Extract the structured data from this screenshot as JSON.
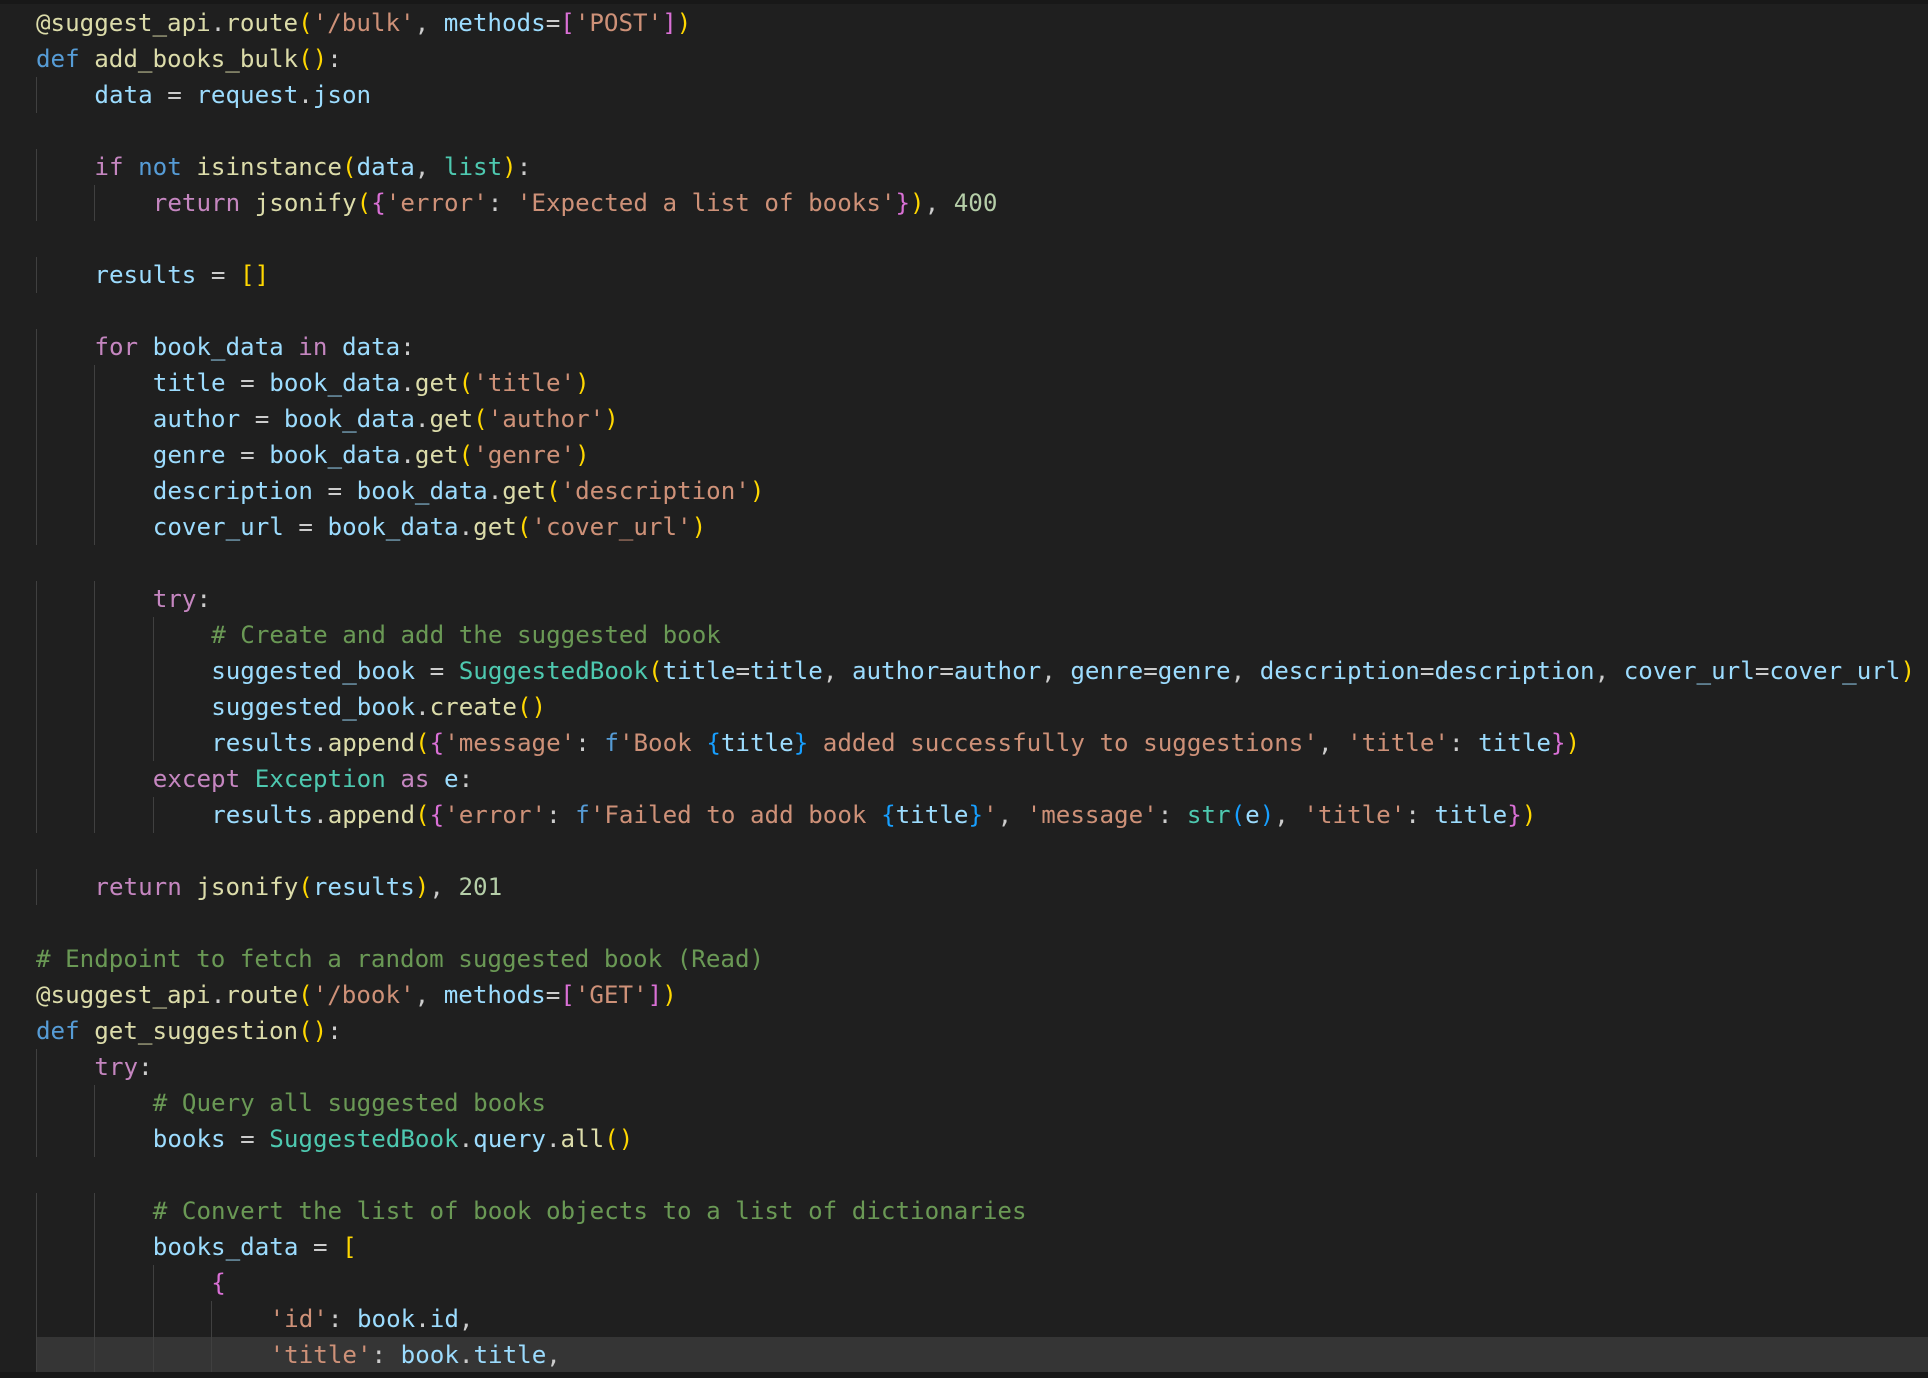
{
  "editor": {
    "language": "python",
    "current_line_index": 37,
    "colors": {
      "background": "#1f1f1f",
      "current_line": "#353535",
      "indent_guide": "#404040",
      "keyword": "#569cd6",
      "control": "#c586c0",
      "function": "#dcdcaa",
      "variable": "#9cdcfe",
      "string": "#ce9178",
      "number": "#b5cea8",
      "comment": "#6a9955",
      "class": "#4ec9b0",
      "bracket_gold": "#ffd700",
      "bracket_purple": "#da70d6",
      "bracket_blue": "#179fff",
      "plain": "#cccccc"
    },
    "lines": [
      {
        "indent": 0,
        "tokens": [
          [
            "@suggest_api",
            "fn"
          ],
          [
            ".",
            "p"
          ],
          [
            "route",
            "fn"
          ],
          [
            "(",
            "b1"
          ],
          [
            "'/bulk'",
            "str"
          ],
          [
            ", ",
            "p"
          ],
          [
            "methods",
            "var"
          ],
          [
            "=",
            "p"
          ],
          [
            "[",
            "b2"
          ],
          [
            "'POST'",
            "str"
          ],
          [
            "]",
            "b2"
          ],
          [
            ")",
            "b1"
          ]
        ]
      },
      {
        "indent": 0,
        "tokens": [
          [
            "def",
            "kw"
          ],
          [
            " ",
            "p"
          ],
          [
            "add_books_bulk",
            "fn"
          ],
          [
            "()",
            "b1"
          ],
          [
            ":",
            "p"
          ]
        ]
      },
      {
        "indent": 1,
        "tokens": [
          [
            "data",
            "var"
          ],
          [
            " = ",
            "p"
          ],
          [
            "request",
            "var"
          ],
          [
            ".",
            "p"
          ],
          [
            "json",
            "var"
          ]
        ]
      },
      {
        "indent": 0,
        "tokens": []
      },
      {
        "indent": 1,
        "tokens": [
          [
            "if",
            "ctl"
          ],
          [
            " ",
            "p"
          ],
          [
            "not",
            "kw"
          ],
          [
            " ",
            "p"
          ],
          [
            "isinstance",
            "fn"
          ],
          [
            "(",
            "b1"
          ],
          [
            "data",
            "var"
          ],
          [
            ", ",
            "p"
          ],
          [
            "list",
            "cls"
          ],
          [
            ")",
            "b1"
          ],
          [
            ":",
            "p"
          ]
        ]
      },
      {
        "indent": 2,
        "tokens": [
          [
            "return",
            "ctl"
          ],
          [
            " ",
            "p"
          ],
          [
            "jsonify",
            "fn"
          ],
          [
            "(",
            "b1"
          ],
          [
            "{",
            "b2"
          ],
          [
            "'error'",
            "str"
          ],
          [
            ": ",
            "p"
          ],
          [
            "'Expected a list of books'",
            "str"
          ],
          [
            "}",
            "b2"
          ],
          [
            ")",
            "b1"
          ],
          [
            ", ",
            "p"
          ],
          [
            "400",
            "num"
          ]
        ]
      },
      {
        "indent": 0,
        "tokens": []
      },
      {
        "indent": 1,
        "tokens": [
          [
            "results",
            "var"
          ],
          [
            " = ",
            "p"
          ],
          [
            "[]",
            "b1"
          ]
        ]
      },
      {
        "indent": 0,
        "tokens": []
      },
      {
        "indent": 1,
        "tokens": [
          [
            "for",
            "ctl"
          ],
          [
            " ",
            "p"
          ],
          [
            "book_data",
            "var"
          ],
          [
            " ",
            "p"
          ],
          [
            "in",
            "ctl"
          ],
          [
            " ",
            "p"
          ],
          [
            "data",
            "var"
          ],
          [
            ":",
            "p"
          ]
        ]
      },
      {
        "indent": 2,
        "tokens": [
          [
            "title",
            "var"
          ],
          [
            " = ",
            "p"
          ],
          [
            "book_data",
            "var"
          ],
          [
            ".",
            "p"
          ],
          [
            "get",
            "fn"
          ],
          [
            "(",
            "b1"
          ],
          [
            "'title'",
            "str"
          ],
          [
            ")",
            "b1"
          ]
        ]
      },
      {
        "indent": 2,
        "tokens": [
          [
            "author",
            "var"
          ],
          [
            " = ",
            "p"
          ],
          [
            "book_data",
            "var"
          ],
          [
            ".",
            "p"
          ],
          [
            "get",
            "fn"
          ],
          [
            "(",
            "b1"
          ],
          [
            "'author'",
            "str"
          ],
          [
            ")",
            "b1"
          ]
        ]
      },
      {
        "indent": 2,
        "tokens": [
          [
            "genre",
            "var"
          ],
          [
            " = ",
            "p"
          ],
          [
            "book_data",
            "var"
          ],
          [
            ".",
            "p"
          ],
          [
            "get",
            "fn"
          ],
          [
            "(",
            "b1"
          ],
          [
            "'genre'",
            "str"
          ],
          [
            ")",
            "b1"
          ]
        ]
      },
      {
        "indent": 2,
        "tokens": [
          [
            "description",
            "var"
          ],
          [
            " = ",
            "p"
          ],
          [
            "book_data",
            "var"
          ],
          [
            ".",
            "p"
          ],
          [
            "get",
            "fn"
          ],
          [
            "(",
            "b1"
          ],
          [
            "'description'",
            "str"
          ],
          [
            ")",
            "b1"
          ]
        ]
      },
      {
        "indent": 2,
        "tokens": [
          [
            "cover_url",
            "var"
          ],
          [
            " = ",
            "p"
          ],
          [
            "book_data",
            "var"
          ],
          [
            ".",
            "p"
          ],
          [
            "get",
            "fn"
          ],
          [
            "(",
            "b1"
          ],
          [
            "'cover_url'",
            "str"
          ],
          [
            ")",
            "b1"
          ]
        ]
      },
      {
        "indent": 0,
        "tokens": []
      },
      {
        "indent": 2,
        "tokens": [
          [
            "try",
            "ctl"
          ],
          [
            ":",
            "p"
          ]
        ]
      },
      {
        "indent": 3,
        "tokens": [
          [
            "# Create and add the suggested book",
            "cmt"
          ]
        ]
      },
      {
        "indent": 3,
        "tokens": [
          [
            "suggested_book",
            "var"
          ],
          [
            " = ",
            "p"
          ],
          [
            "SuggestedBook",
            "cls"
          ],
          [
            "(",
            "b1"
          ],
          [
            "title",
            "var"
          ],
          [
            "=",
            "p"
          ],
          [
            "title",
            "var"
          ],
          [
            ", ",
            "p"
          ],
          [
            "author",
            "var"
          ],
          [
            "=",
            "p"
          ],
          [
            "author",
            "var"
          ],
          [
            ", ",
            "p"
          ],
          [
            "genre",
            "var"
          ],
          [
            "=",
            "p"
          ],
          [
            "genre",
            "var"
          ],
          [
            ", ",
            "p"
          ],
          [
            "description",
            "var"
          ],
          [
            "=",
            "p"
          ],
          [
            "description",
            "var"
          ],
          [
            ", ",
            "p"
          ],
          [
            "cover_url",
            "var"
          ],
          [
            "=",
            "p"
          ],
          [
            "cover_url",
            "var"
          ],
          [
            ")",
            "b1"
          ]
        ]
      },
      {
        "indent": 3,
        "tokens": [
          [
            "suggested_book",
            "var"
          ],
          [
            ".",
            "p"
          ],
          [
            "create",
            "fn"
          ],
          [
            "()",
            "b1"
          ]
        ]
      },
      {
        "indent": 3,
        "tokens": [
          [
            "results",
            "var"
          ],
          [
            ".",
            "p"
          ],
          [
            "append",
            "fn"
          ],
          [
            "(",
            "b1"
          ],
          [
            "{",
            "b2"
          ],
          [
            "'message'",
            "str"
          ],
          [
            ": ",
            "p"
          ],
          [
            "f",
            "kw"
          ],
          [
            "'Book ",
            "str"
          ],
          [
            "{",
            "b3"
          ],
          [
            "title",
            "var"
          ],
          [
            "}",
            "b3"
          ],
          [
            " added successfully to suggestions'",
            "str"
          ],
          [
            ", ",
            "p"
          ],
          [
            "'title'",
            "str"
          ],
          [
            ": ",
            "p"
          ],
          [
            "title",
            "var"
          ],
          [
            "}",
            "b2"
          ],
          [
            ")",
            "b1"
          ]
        ]
      },
      {
        "indent": 2,
        "tokens": [
          [
            "except",
            "ctl"
          ],
          [
            " ",
            "p"
          ],
          [
            "Exception",
            "cls"
          ],
          [
            " ",
            "p"
          ],
          [
            "as",
            "ctl"
          ],
          [
            " ",
            "p"
          ],
          [
            "e",
            "var"
          ],
          [
            ":",
            "p"
          ]
        ]
      },
      {
        "indent": 3,
        "tokens": [
          [
            "results",
            "var"
          ],
          [
            ".",
            "p"
          ],
          [
            "append",
            "fn"
          ],
          [
            "(",
            "b1"
          ],
          [
            "{",
            "b2"
          ],
          [
            "'error'",
            "str"
          ],
          [
            ": ",
            "p"
          ],
          [
            "f",
            "kw"
          ],
          [
            "'Failed to add book ",
            "str"
          ],
          [
            "{",
            "b3"
          ],
          [
            "title",
            "var"
          ],
          [
            "}",
            "b3"
          ],
          [
            "'",
            "str"
          ],
          [
            ", ",
            "p"
          ],
          [
            "'message'",
            "str"
          ],
          [
            ": ",
            "p"
          ],
          [
            "str",
            "cls"
          ],
          [
            "(",
            "b3"
          ],
          [
            "e",
            "var"
          ],
          [
            ")",
            "b3"
          ],
          [
            ", ",
            "p"
          ],
          [
            "'title'",
            "str"
          ],
          [
            ": ",
            "p"
          ],
          [
            "title",
            "var"
          ],
          [
            "}",
            "b2"
          ],
          [
            ")",
            "b1"
          ]
        ]
      },
      {
        "indent": 0,
        "tokens": []
      },
      {
        "indent": 1,
        "tokens": [
          [
            "return",
            "ctl"
          ],
          [
            " ",
            "p"
          ],
          [
            "jsonify",
            "fn"
          ],
          [
            "(",
            "b1"
          ],
          [
            "results",
            "var"
          ],
          [
            ")",
            "b1"
          ],
          [
            ", ",
            "p"
          ],
          [
            "201",
            "num"
          ]
        ]
      },
      {
        "indent": 0,
        "tokens": []
      },
      {
        "indent": 0,
        "tokens": [
          [
            "# Endpoint to fetch a random suggested book (Read)",
            "cmt"
          ]
        ]
      },
      {
        "indent": 0,
        "tokens": [
          [
            "@suggest_api",
            "fn"
          ],
          [
            ".",
            "p"
          ],
          [
            "route",
            "fn"
          ],
          [
            "(",
            "b1"
          ],
          [
            "'/book'",
            "str"
          ],
          [
            ", ",
            "p"
          ],
          [
            "methods",
            "var"
          ],
          [
            "=",
            "p"
          ],
          [
            "[",
            "b2"
          ],
          [
            "'GET'",
            "str"
          ],
          [
            "]",
            "b2"
          ],
          [
            ")",
            "b1"
          ]
        ]
      },
      {
        "indent": 0,
        "tokens": [
          [
            "def",
            "kw"
          ],
          [
            " ",
            "p"
          ],
          [
            "get_suggestion",
            "fn"
          ],
          [
            "()",
            "b1"
          ],
          [
            ":",
            "p"
          ]
        ]
      },
      {
        "indent": 1,
        "tokens": [
          [
            "try",
            "ctl"
          ],
          [
            ":",
            "p"
          ]
        ]
      },
      {
        "indent": 2,
        "tokens": [
          [
            "# Query all suggested books",
            "cmt"
          ]
        ]
      },
      {
        "indent": 2,
        "tokens": [
          [
            "books",
            "var"
          ],
          [
            " = ",
            "p"
          ],
          [
            "SuggestedBook",
            "cls"
          ],
          [
            ".",
            "p"
          ],
          [
            "query",
            "var"
          ],
          [
            ".",
            "p"
          ],
          [
            "all",
            "fn"
          ],
          [
            "()",
            "b1"
          ]
        ]
      },
      {
        "indent": 0,
        "tokens": []
      },
      {
        "indent": 2,
        "tokens": [
          [
            "# Convert the list of book objects to a list of dictionaries",
            "cmt"
          ]
        ]
      },
      {
        "indent": 2,
        "tokens": [
          [
            "books_data",
            "var"
          ],
          [
            " = ",
            "p"
          ],
          [
            "[",
            "b1"
          ]
        ]
      },
      {
        "indent": 3,
        "tokens": [
          [
            "{",
            "b2"
          ]
        ]
      },
      {
        "indent": 4,
        "tokens": [
          [
            "'id'",
            "str"
          ],
          [
            ": ",
            "p"
          ],
          [
            "book",
            "var"
          ],
          [
            ".",
            "p"
          ],
          [
            "id",
            "var"
          ],
          [
            ",",
            "p"
          ]
        ]
      },
      {
        "indent": 4,
        "tokens": [
          [
            "'title'",
            "str"
          ],
          [
            ": ",
            "p"
          ],
          [
            "book",
            "var"
          ],
          [
            ".",
            "p"
          ],
          [
            "title",
            "var"
          ],
          [
            ",",
            "p"
          ]
        ]
      }
    ]
  }
}
